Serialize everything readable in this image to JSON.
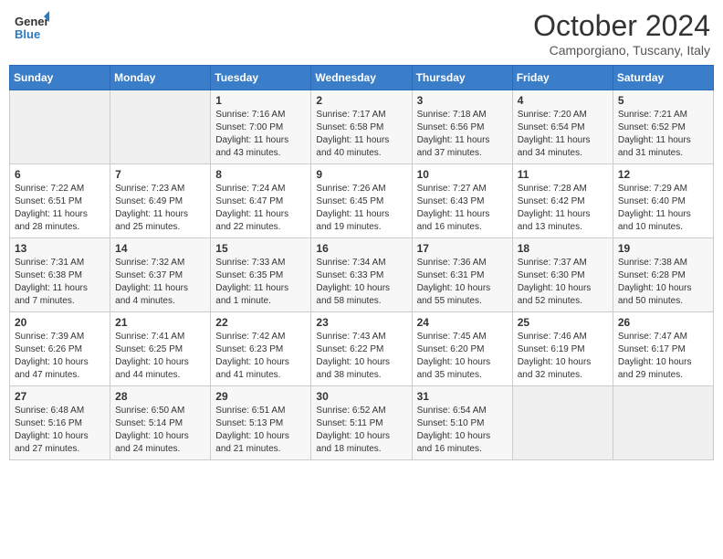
{
  "header": {
    "logo": {
      "general": "General",
      "blue": "Blue"
    },
    "title": "October 2024",
    "subtitle": "Camporgiano, Tuscany, Italy"
  },
  "days_of_week": [
    "Sunday",
    "Monday",
    "Tuesday",
    "Wednesday",
    "Thursday",
    "Friday",
    "Saturday"
  ],
  "weeks": [
    [
      {
        "day": "",
        "info": ""
      },
      {
        "day": "",
        "info": ""
      },
      {
        "day": "1",
        "info": "Sunrise: 7:16 AM\nSunset: 7:00 PM\nDaylight: 11 hours\nand 43 minutes."
      },
      {
        "day": "2",
        "info": "Sunrise: 7:17 AM\nSunset: 6:58 PM\nDaylight: 11 hours\nand 40 minutes."
      },
      {
        "day": "3",
        "info": "Sunrise: 7:18 AM\nSunset: 6:56 PM\nDaylight: 11 hours\nand 37 minutes."
      },
      {
        "day": "4",
        "info": "Sunrise: 7:20 AM\nSunset: 6:54 PM\nDaylight: 11 hours\nand 34 minutes."
      },
      {
        "day": "5",
        "info": "Sunrise: 7:21 AM\nSunset: 6:52 PM\nDaylight: 11 hours\nand 31 minutes."
      }
    ],
    [
      {
        "day": "6",
        "info": "Sunrise: 7:22 AM\nSunset: 6:51 PM\nDaylight: 11 hours\nand 28 minutes."
      },
      {
        "day": "7",
        "info": "Sunrise: 7:23 AM\nSunset: 6:49 PM\nDaylight: 11 hours\nand 25 minutes."
      },
      {
        "day": "8",
        "info": "Sunrise: 7:24 AM\nSunset: 6:47 PM\nDaylight: 11 hours\nand 22 minutes."
      },
      {
        "day": "9",
        "info": "Sunrise: 7:26 AM\nSunset: 6:45 PM\nDaylight: 11 hours\nand 19 minutes."
      },
      {
        "day": "10",
        "info": "Sunrise: 7:27 AM\nSunset: 6:43 PM\nDaylight: 11 hours\nand 16 minutes."
      },
      {
        "day": "11",
        "info": "Sunrise: 7:28 AM\nSunset: 6:42 PM\nDaylight: 11 hours\nand 13 minutes."
      },
      {
        "day": "12",
        "info": "Sunrise: 7:29 AM\nSunset: 6:40 PM\nDaylight: 11 hours\nand 10 minutes."
      }
    ],
    [
      {
        "day": "13",
        "info": "Sunrise: 7:31 AM\nSunset: 6:38 PM\nDaylight: 11 hours\nand 7 minutes."
      },
      {
        "day": "14",
        "info": "Sunrise: 7:32 AM\nSunset: 6:37 PM\nDaylight: 11 hours\nand 4 minutes."
      },
      {
        "day": "15",
        "info": "Sunrise: 7:33 AM\nSunset: 6:35 PM\nDaylight: 11 hours\nand 1 minute."
      },
      {
        "day": "16",
        "info": "Sunrise: 7:34 AM\nSunset: 6:33 PM\nDaylight: 10 hours\nand 58 minutes."
      },
      {
        "day": "17",
        "info": "Sunrise: 7:36 AM\nSunset: 6:31 PM\nDaylight: 10 hours\nand 55 minutes."
      },
      {
        "day": "18",
        "info": "Sunrise: 7:37 AM\nSunset: 6:30 PM\nDaylight: 10 hours\nand 52 minutes."
      },
      {
        "day": "19",
        "info": "Sunrise: 7:38 AM\nSunset: 6:28 PM\nDaylight: 10 hours\nand 50 minutes."
      }
    ],
    [
      {
        "day": "20",
        "info": "Sunrise: 7:39 AM\nSunset: 6:26 PM\nDaylight: 10 hours\nand 47 minutes."
      },
      {
        "day": "21",
        "info": "Sunrise: 7:41 AM\nSunset: 6:25 PM\nDaylight: 10 hours\nand 44 minutes."
      },
      {
        "day": "22",
        "info": "Sunrise: 7:42 AM\nSunset: 6:23 PM\nDaylight: 10 hours\nand 41 minutes."
      },
      {
        "day": "23",
        "info": "Sunrise: 7:43 AM\nSunset: 6:22 PM\nDaylight: 10 hours\nand 38 minutes."
      },
      {
        "day": "24",
        "info": "Sunrise: 7:45 AM\nSunset: 6:20 PM\nDaylight: 10 hours\nand 35 minutes."
      },
      {
        "day": "25",
        "info": "Sunrise: 7:46 AM\nSunset: 6:19 PM\nDaylight: 10 hours\nand 32 minutes."
      },
      {
        "day": "26",
        "info": "Sunrise: 7:47 AM\nSunset: 6:17 PM\nDaylight: 10 hours\nand 29 minutes."
      }
    ],
    [
      {
        "day": "27",
        "info": "Sunrise: 6:48 AM\nSunset: 5:16 PM\nDaylight: 10 hours\nand 27 minutes."
      },
      {
        "day": "28",
        "info": "Sunrise: 6:50 AM\nSunset: 5:14 PM\nDaylight: 10 hours\nand 24 minutes."
      },
      {
        "day": "29",
        "info": "Sunrise: 6:51 AM\nSunset: 5:13 PM\nDaylight: 10 hours\nand 21 minutes."
      },
      {
        "day": "30",
        "info": "Sunrise: 6:52 AM\nSunset: 5:11 PM\nDaylight: 10 hours\nand 18 minutes."
      },
      {
        "day": "31",
        "info": "Sunrise: 6:54 AM\nSunset: 5:10 PM\nDaylight: 10 hours\nand 16 minutes."
      },
      {
        "day": "",
        "info": ""
      },
      {
        "day": "",
        "info": ""
      }
    ]
  ]
}
